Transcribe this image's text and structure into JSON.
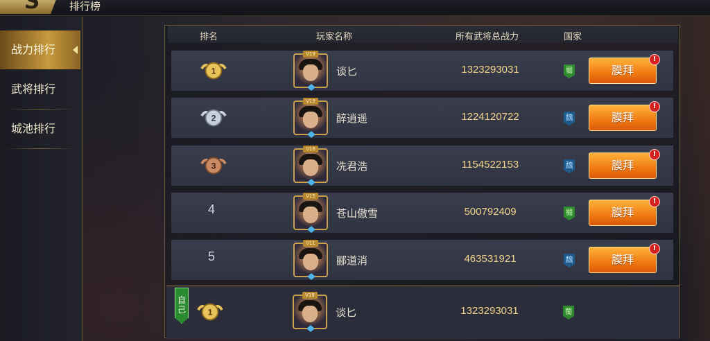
{
  "header_bar": {
    "logo_text": "S",
    "title": "排行榜"
  },
  "sidebar": {
    "items": [
      {
        "label": "战力排行",
        "active": true
      },
      {
        "label": "武将排行",
        "active": false
      },
      {
        "label": "城池排行",
        "active": false
      }
    ]
  },
  "table": {
    "columns": {
      "rank": "排名",
      "player": "玩家名称",
      "power": "所有武将总战力",
      "country": "国家"
    },
    "rows": [
      {
        "rank": "1",
        "vip": "V19",
        "name": "谈匕",
        "power": "1323293031",
        "country": "蜀",
        "country_key": "shu",
        "button": "膜拜",
        "alert": "!"
      },
      {
        "rank": "2",
        "vip": "V19",
        "name": "醉逍遥",
        "power": "1224120722",
        "country": "魏",
        "country_key": "wei",
        "button": "膜拜",
        "alert": "!"
      },
      {
        "rank": "3",
        "vip": "V16",
        "name": "冼君浩",
        "power": "1154522153",
        "country": "魏",
        "country_key": "wei",
        "button": "膜拜",
        "alert": "!"
      },
      {
        "rank": "4",
        "vip": "V15",
        "name": "苍山傲雪",
        "power": "500792409",
        "country": "蜀",
        "country_key": "shu",
        "button": "膜拜",
        "alert": "!"
      },
      {
        "rank": "5",
        "vip": "V11",
        "name": "郦道消",
        "power": "463531921",
        "country": "魏",
        "country_key": "wei",
        "button": "膜拜",
        "alert": "!"
      }
    ],
    "self_row": {
      "tag": "自己",
      "rank": "1",
      "vip": "V19",
      "name": "谈匕",
      "power": "1323293031",
      "country": "蜀"
    }
  },
  "colors": {
    "gold": "#e8c35a",
    "silver": "#c8d0dc",
    "bronze": "#c98a64",
    "button": "#f07a12",
    "shu": "#2f8a2f",
    "wei": "#1e5a8a"
  }
}
